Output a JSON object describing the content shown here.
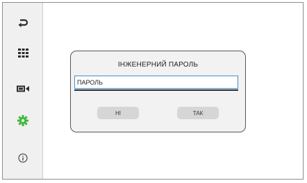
{
  "sidebar": {
    "items": [
      {
        "icon": "back-icon",
        "active": false
      },
      {
        "icon": "apps-grid-icon",
        "active": false
      },
      {
        "icon": "camera-icon",
        "active": false
      },
      {
        "icon": "settings-gear-icon",
        "active": true
      },
      {
        "icon": "info-icon",
        "active": false
      }
    ]
  },
  "dialog": {
    "title": "ІНЖЕНЕРНИЙ ПАРОЛЬ",
    "password_placeholder": "ПАРОЛЬ",
    "no_label": "НІ",
    "yes_label": "ТАК"
  },
  "colors": {
    "accent_green": "#3cb83c",
    "field_border": "#3c8fd0",
    "icon_dark": "#2b2b2b"
  }
}
